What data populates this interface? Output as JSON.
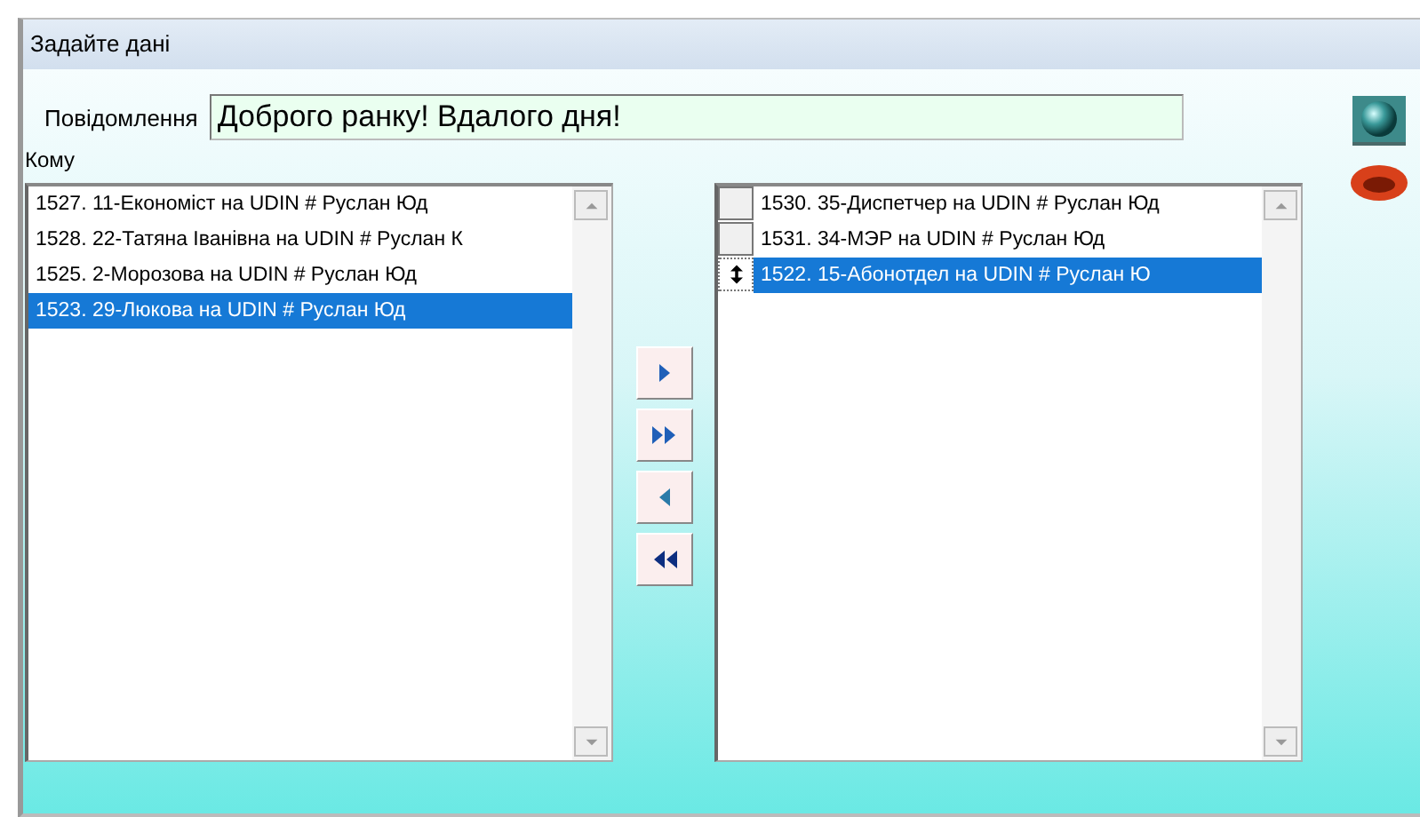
{
  "window": {
    "title": "Задайте дані"
  },
  "message": {
    "label": "Повідомлення",
    "value": "Доброго ранку! Вдалого дня!"
  },
  "recipients_label": "Кому",
  "available": [
    {
      "text": "1527. 11-Економіст на UDIN # Руслан Юд",
      "selected": false
    },
    {
      "text": "1528. 22-Татяна Іванівна на UDIN # Руслан К",
      "selected": false
    },
    {
      "text": "1525. 2-Морозова на UDIN # Руслан Юд",
      "selected": false
    },
    {
      "text": "1523. 29-Люкова на UDIN # Руслан Юд",
      "selected": true
    }
  ],
  "chosen": [
    {
      "text": "1530. 35-Диспетчер на UDIN # Руслан Юд",
      "selected": false,
      "current": false
    },
    {
      "text": "1531. 34-МЭР на UDIN # Руслан Юд",
      "selected": false,
      "current": false
    },
    {
      "text": "1522. 15-Абонотдел на UDIN # Руслан Ю",
      "selected": true,
      "current": true
    }
  ],
  "move_buttons": [
    {
      "kind": "one-right"
    },
    {
      "kind": "all-right"
    },
    {
      "kind": "one-left"
    },
    {
      "kind": "all-left"
    }
  ]
}
